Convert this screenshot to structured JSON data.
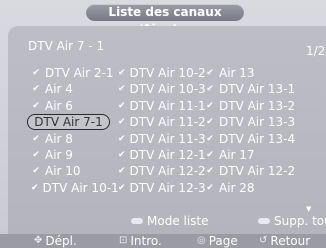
{
  "window": {
    "title": "Liste des canaux /Ajouter"
  },
  "header": {
    "channel": "DTV Air 7 - 1",
    "page": "1/2"
  },
  "channels": [
    {
      "label": "DTV Air 2-1",
      "checked": true
    },
    {
      "label": "DTV Air 10-2",
      "checked": true
    },
    {
      "label": "Air 13",
      "checked": true
    },
    {
      "label": "Air 4",
      "checked": true
    },
    {
      "label": "DTV Air 10-3",
      "checked": true
    },
    {
      "label": "DTV Air 13-1",
      "checked": true
    },
    {
      "label": "Air 6",
      "checked": true
    },
    {
      "label": "DTV Air 11-1",
      "checked": true
    },
    {
      "label": "DTV Air 13-2",
      "checked": true
    },
    {
      "label": "DTV Air 7-1",
      "checked": false,
      "selected": true
    },
    {
      "label": "DTV Air 11-2",
      "checked": true
    },
    {
      "label": "DTV Air 13-3",
      "checked": true
    },
    {
      "label": "Air 8",
      "checked": true
    },
    {
      "label": "DTV Air 11-3",
      "checked": true
    },
    {
      "label": "DTV Air 13-4",
      "checked": true
    },
    {
      "label": "Air 9",
      "checked": true
    },
    {
      "label": "DTV Air 12-1",
      "checked": true
    },
    {
      "label": "Air 17",
      "checked": true
    },
    {
      "label": "Air 10",
      "checked": true
    },
    {
      "label": "DTV Air 12-2",
      "checked": true
    },
    {
      "label": "DTV Air 12-2",
      "checked": true
    },
    {
      "label": "DTV Air 10-1",
      "checked": true
    },
    {
      "label": "DTV Air 12-3",
      "checked": true
    },
    {
      "label": "Air 28",
      "checked": true
    }
  ],
  "actions": {
    "mode_list": "Mode liste",
    "delete_all": "Supp. tout"
  },
  "nav": {
    "move": "Dépl.",
    "enter": "Intro.",
    "page": "Page",
    "back": "Retour"
  },
  "icons": {
    "check": "check-icon",
    "scroll": "scroll-down-icon",
    "move": "dpad-icon",
    "enter": "enter-icon",
    "page": "page-icon",
    "back": "return-icon"
  },
  "colors": {
    "background": "#c9cad0",
    "title_bar": "#777a86",
    "nav_bar": "#9a9ba3",
    "text": "#ffffff"
  }
}
